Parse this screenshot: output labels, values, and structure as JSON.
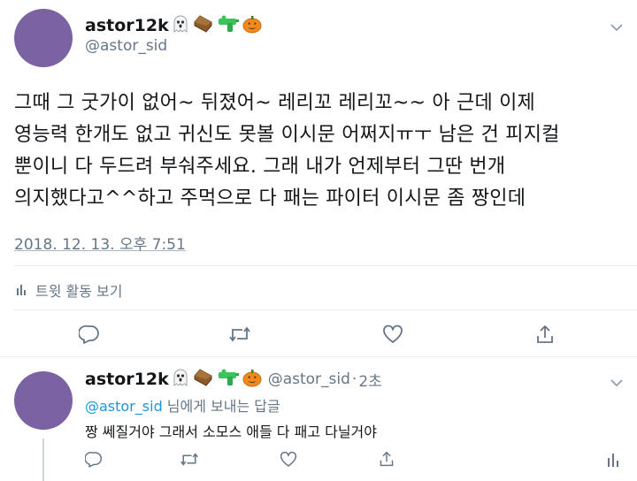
{
  "main_tweet": {
    "display_name": "astor12k",
    "emojis": [
      "ghost-icon",
      "coffin-icon",
      "water-gun-icon",
      "pumpkin-icon"
    ],
    "handle": "@astor_sid",
    "text_lines": [
      "그때 그 굿가이 없어~ 뒤졌어~ 레리꼬 레리꼬~~ 아 근데 이제",
      "영능력 한개도 없고 귀신도 못볼 이시문 어쩌지ㅠㅜ 남은 건 피지컬",
      "뿐이니 다 두드려 부숴주세요. 그래 내가 언제부터 그딴 번개",
      "의지했다고^^하고 주먹으로 다 패는 파이터 이시문 좀 짱인데"
    ],
    "timestamp": "2018. 12. 13. 오후 7:51",
    "activity_label": "트윗 활동 보기"
  },
  "reply": {
    "display_name": "astor12k",
    "emojis": [
      "ghost-icon",
      "coffin-icon",
      "water-gun-icon",
      "pumpkin-icon"
    ],
    "handle": "@astor_sid",
    "separator": "·",
    "age": "2초",
    "replying_to_handle": "@astor_sid",
    "replying_to_suffix": " 님에게 보내는 답글",
    "text": "짱 쎄질거야 그래서 소모스 애들 다 패고 다닐거야"
  },
  "colors": {
    "avatar": "#7a62a3",
    "link": "#1b95e0",
    "muted": "#657786",
    "divider": "#e6ecf0"
  }
}
